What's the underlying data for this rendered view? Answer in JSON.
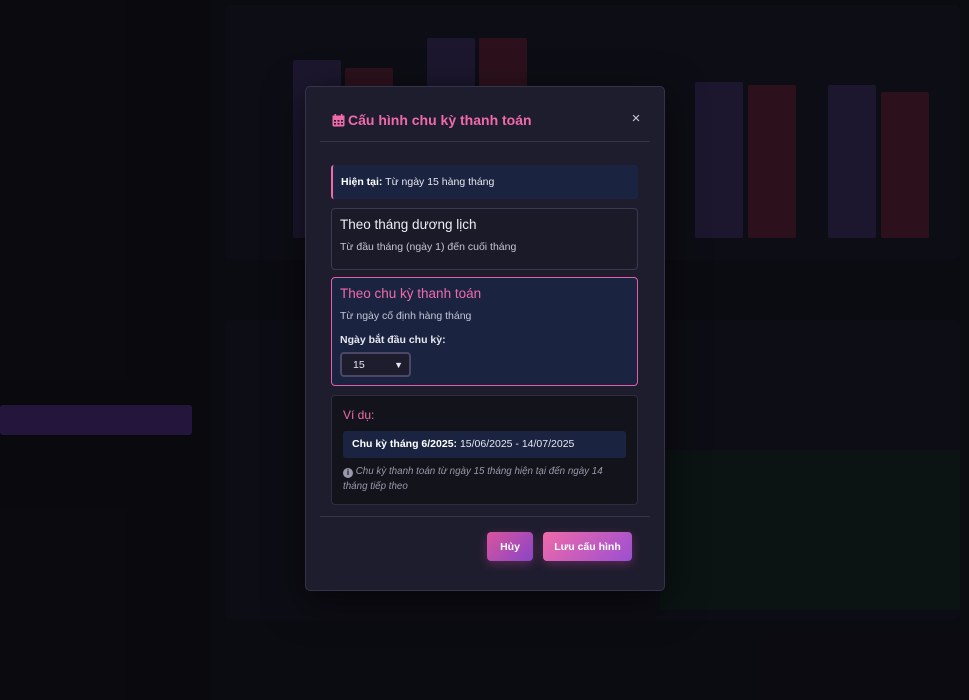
{
  "modal": {
    "title": "Cấu hình chu kỳ thanh toán",
    "close_label": "×",
    "current": {
      "label": "Hiện tại:",
      "value": "Từ ngày 15 hàng tháng"
    },
    "options": [
      {
        "title": "Theo tháng dương lịch",
        "description": "Từ đầu tháng (ngày 1) đến cuối tháng",
        "selected": false
      },
      {
        "title": "Theo chu kỳ thanh toán",
        "description": "Từ ngày cố định hàng tháng",
        "selected": true,
        "start_day_label": "Ngày bắt đầu chu kỳ:",
        "start_day_value": "15"
      }
    ],
    "example": {
      "title": "Ví dụ:",
      "cycle_label": "Chu kỳ tháng 6/2025:",
      "cycle_range": "15/06/2025 - 14/07/2025",
      "note": "Chu kỳ thanh toán từ ngày 15 tháng hiện tại đến ngày 14 tháng tiếp theo"
    },
    "buttons": {
      "cancel": "Hủy",
      "save": "Lưu cấu hình"
    }
  },
  "colors": {
    "accent": "#f06aa9",
    "modal_bg": "#1e1d2e",
    "highlight_bg": "#1a2441"
  }
}
